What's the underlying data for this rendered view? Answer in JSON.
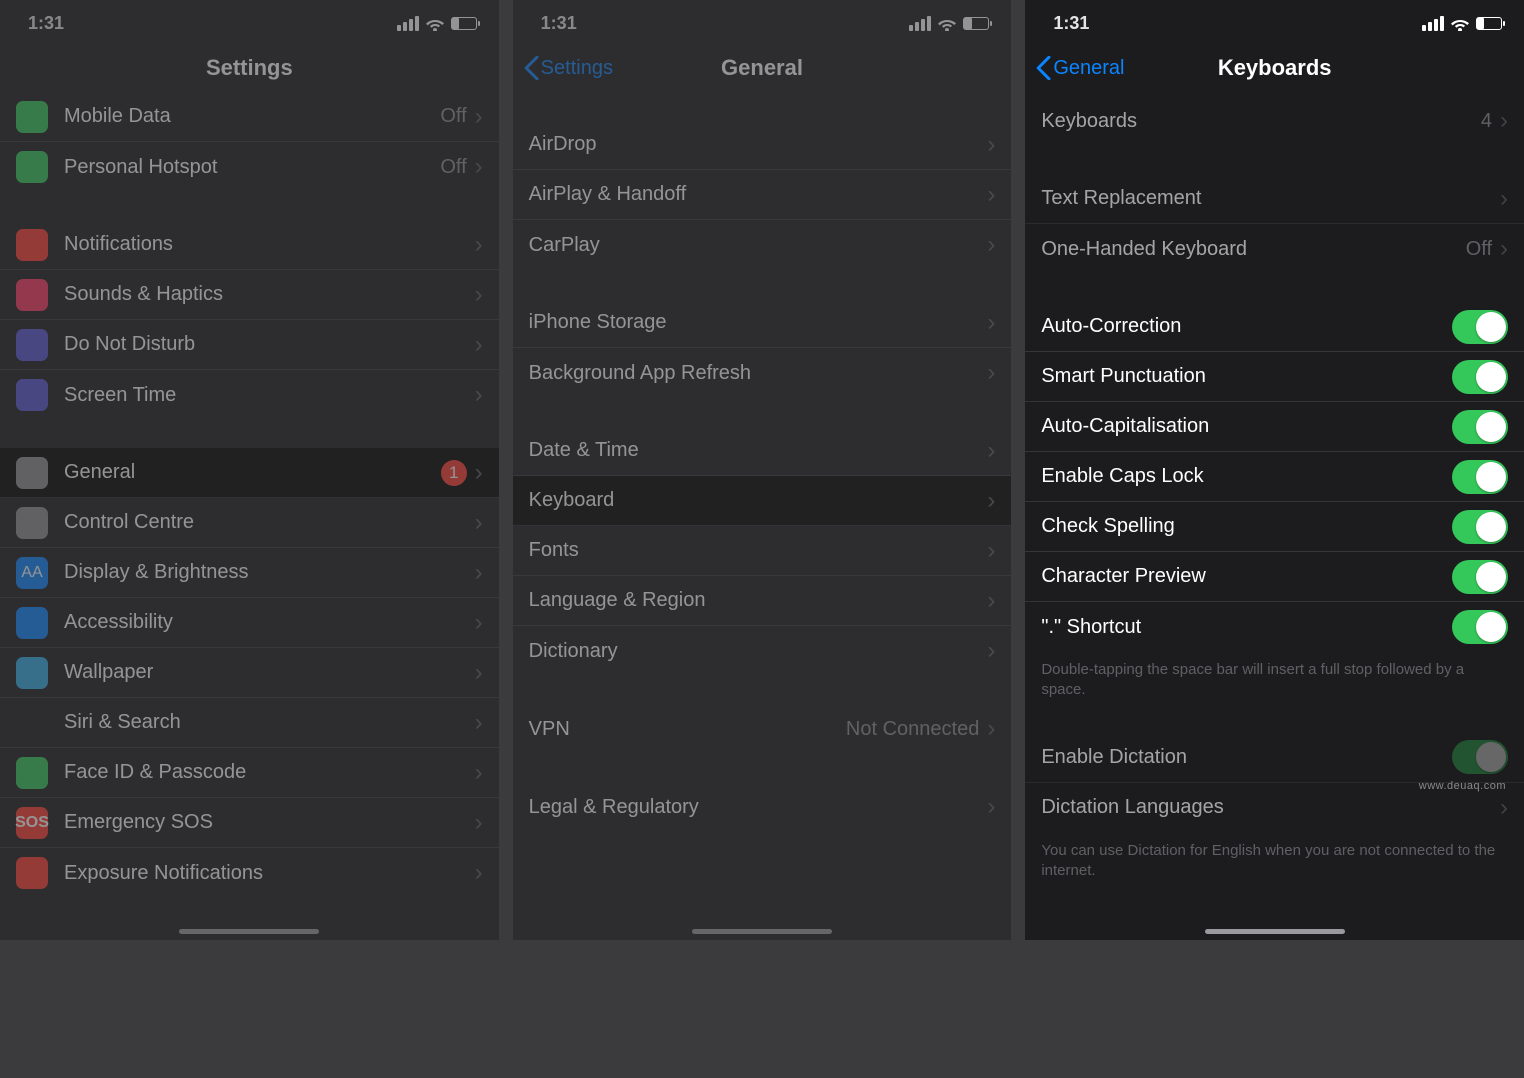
{
  "status": {
    "time": "1:31"
  },
  "watermark": "www.deuaq.com",
  "screen1": {
    "title": "Settings",
    "groups": [
      [
        {
          "icon": "antenna-icon",
          "iconClass": "ic-green",
          "label": "Mobile Data",
          "value": "Off"
        },
        {
          "icon": "link-icon",
          "iconClass": "ic-green",
          "label": "Personal Hotspot",
          "value": "Off"
        }
      ],
      [
        {
          "icon": "bell-icon",
          "iconClass": "ic-red",
          "label": "Notifications"
        },
        {
          "icon": "speaker-icon",
          "iconClass": "ic-redpink",
          "label": "Sounds & Haptics"
        },
        {
          "icon": "moon-icon",
          "iconClass": "ic-indigo",
          "label": "Do Not Disturb"
        },
        {
          "icon": "hourglass-icon",
          "iconClass": "ic-indigo",
          "label": "Screen Time"
        }
      ],
      [
        {
          "icon": "gear-icon",
          "iconClass": "ic-gray",
          "label": "General",
          "badge": "1",
          "selected": true
        },
        {
          "icon": "switches-icon",
          "iconClass": "ic-gray",
          "label": "Control Centre"
        },
        {
          "icon": "aa-icon",
          "iconClass": "ic-blue",
          "label": "Display & Brightness",
          "iconText": "AA"
        },
        {
          "icon": "person-icon",
          "iconClass": "ic-blue",
          "label": "Accessibility"
        },
        {
          "icon": "flower-icon",
          "iconClass": "ic-teal",
          "label": "Wallpaper"
        },
        {
          "icon": "siri-icon",
          "iconClass": "ic-black",
          "label": "Siri & Search"
        },
        {
          "icon": "faceid-icon",
          "iconClass": "ic-green",
          "label": "Face ID & Passcode"
        },
        {
          "icon": "sos-icon",
          "iconClass": "ic-sos",
          "label": "Emergency SOS",
          "iconText": "SOS"
        },
        {
          "icon": "virus-icon",
          "iconClass": "ic-red",
          "label": "Exposure Notifications"
        }
      ]
    ]
  },
  "screen2": {
    "back": "Settings",
    "title": "General",
    "groups": [
      [
        {
          "label": "AirDrop"
        },
        {
          "label": "AirPlay & Handoff"
        },
        {
          "label": "CarPlay"
        }
      ],
      [
        {
          "label": "iPhone Storage"
        },
        {
          "label": "Background App Refresh"
        }
      ],
      [
        {
          "label": "Date & Time"
        },
        {
          "label": "Keyboard",
          "selected": true
        },
        {
          "label": "Fonts"
        },
        {
          "label": "Language & Region"
        },
        {
          "label": "Dictionary"
        }
      ],
      [
        {
          "label": "VPN",
          "value": "Not Connected"
        }
      ],
      [
        {
          "label": "Legal & Regulatory"
        }
      ]
    ]
  },
  "screen3": {
    "back": "General",
    "title": "Keyboards",
    "groups": [
      {
        "rows": [
          {
            "label": "Keyboards",
            "value": "4"
          }
        ]
      },
      {
        "rows": [
          {
            "label": "Text Replacement"
          },
          {
            "label": "One-Handed Keyboard",
            "value": "Off"
          }
        ]
      },
      {
        "rows": [
          {
            "label": "Auto-Correction",
            "toggle": true
          },
          {
            "label": "Smart Punctuation",
            "toggle": true
          },
          {
            "label": "Auto-Capitalisation",
            "toggle": true
          },
          {
            "label": "Enable Caps Lock",
            "toggle": true
          },
          {
            "label": "Check Spelling",
            "toggle": true
          },
          {
            "label": "Character Preview",
            "toggle": true
          },
          {
            "label": "\".\" Shortcut",
            "toggle": true
          }
        ],
        "footer": "Double-tapping the space bar will insert a full stop followed by a space."
      },
      {
        "rows": [
          {
            "label": "Enable Dictation",
            "toggle": true,
            "toggleDim": true
          },
          {
            "label": "Dictation Languages"
          }
        ],
        "footer": "You can use Dictation for English when you are not connected to the internet."
      }
    ]
  }
}
